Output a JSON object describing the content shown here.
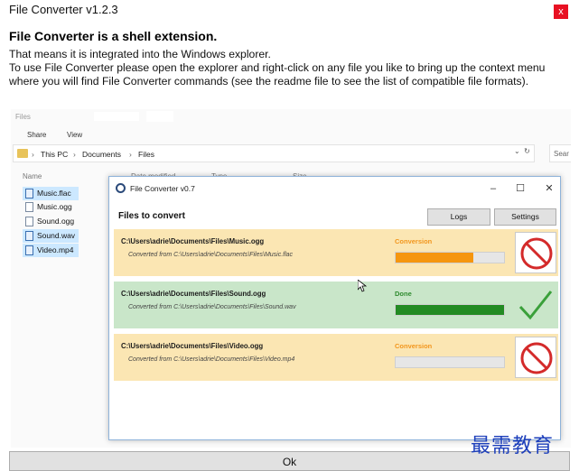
{
  "window": {
    "title": "File Converter v1.2.3",
    "close_glyph": "x"
  },
  "intro": {
    "heading": "File Converter is a shell extension.",
    "line1": "That means it is integrated into the Windows explorer.",
    "line2": "To use File Converter please open the explorer and right-click on any file you like to bring up the context menu where you will find File Converter commands (see the readme file to see the list of compatible file formats)."
  },
  "explorer": {
    "title": "Files",
    "ribbon": [
      "Share",
      "View"
    ],
    "breadcrumb": [
      "This PC",
      "Documents",
      "Files"
    ],
    "search_placeholder": "Sear",
    "columns": {
      "name": "Name",
      "date": "Date modified",
      "type": "Type",
      "size": "Size"
    },
    "files": [
      {
        "name": "Music.flac",
        "selected": true,
        "icon": "audio-file-icon"
      },
      {
        "name": "Music.ogg",
        "selected": false,
        "icon": "file-icon"
      },
      {
        "name": "Sound.ogg",
        "selected": false,
        "icon": "file-icon"
      },
      {
        "name": "Sound.wav",
        "selected": true,
        "icon": "audio-file-icon"
      },
      {
        "name": "Video.mp4",
        "selected": true,
        "icon": "video-file-icon"
      }
    ]
  },
  "converter": {
    "title": "File Converter v0.7",
    "section_title": "Files to convert",
    "logs_label": "Logs",
    "settings_label": "Settings",
    "jobs": [
      {
        "path": "C:\\Users\\adrie\\Documents\\Files\\Music.ogg",
        "from": "Converted from C:\\Users\\adrie\\Documents\\Files\\Music.flac",
        "status": "Conversion",
        "progress": 0.72,
        "state": "pending"
      },
      {
        "path": "C:\\Users\\adrie\\Documents\\Files\\Sound.ogg",
        "from": "Converted from C:\\Users\\adrie\\Documents\\Files\\Sound.wav",
        "status": "Done",
        "progress": 1.0,
        "state": "done"
      },
      {
        "path": "C:\\Users\\adrie\\Documents\\Files\\Video.ogg",
        "from": "Converted from C:\\Users\\adrie\\Documents\\Files\\Video.mp4",
        "status": "Conversion",
        "progress": 0.0,
        "state": "pending"
      }
    ]
  },
  "ok_label": "Ok",
  "watermark": "最需教育",
  "colors": {
    "pending_bg": "#fbe6b3",
    "done_bg": "#c9e6c9",
    "progress_orange": "#f5960f",
    "progress_green": "#238b23",
    "cancel_red": "#d42a2a",
    "check_green": "#3aa03a"
  }
}
